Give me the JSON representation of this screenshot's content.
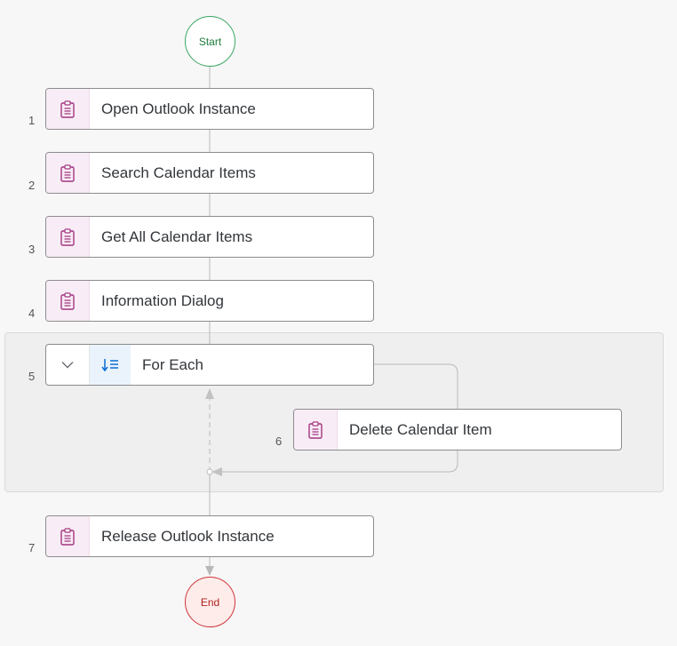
{
  "flow": {
    "start_label": "Start",
    "end_label": "End",
    "steps": [
      {
        "number": "1",
        "label": "Open Outlook Instance"
      },
      {
        "number": "2",
        "label": "Search Calendar Items"
      },
      {
        "number": "3",
        "label": "Get All Calendar Items"
      },
      {
        "number": "4",
        "label": "Information Dialog"
      },
      {
        "number": "5",
        "label": "For Each"
      },
      {
        "number": "6",
        "label": "Delete Calendar Item"
      },
      {
        "number": "7",
        "label": "Release Outlook Instance"
      }
    ]
  },
  "icons": {
    "activity": "clipboard-icon",
    "loop": "sort-list-icon",
    "collapse": "chevron-down-icon"
  },
  "colors": {
    "start_border": "#3aa565",
    "end_border": "#d0343a",
    "activity_icon_bg": "#f8ecf6",
    "activity_icon": "#a2357f",
    "loop_icon": "#0a6ed1"
  }
}
